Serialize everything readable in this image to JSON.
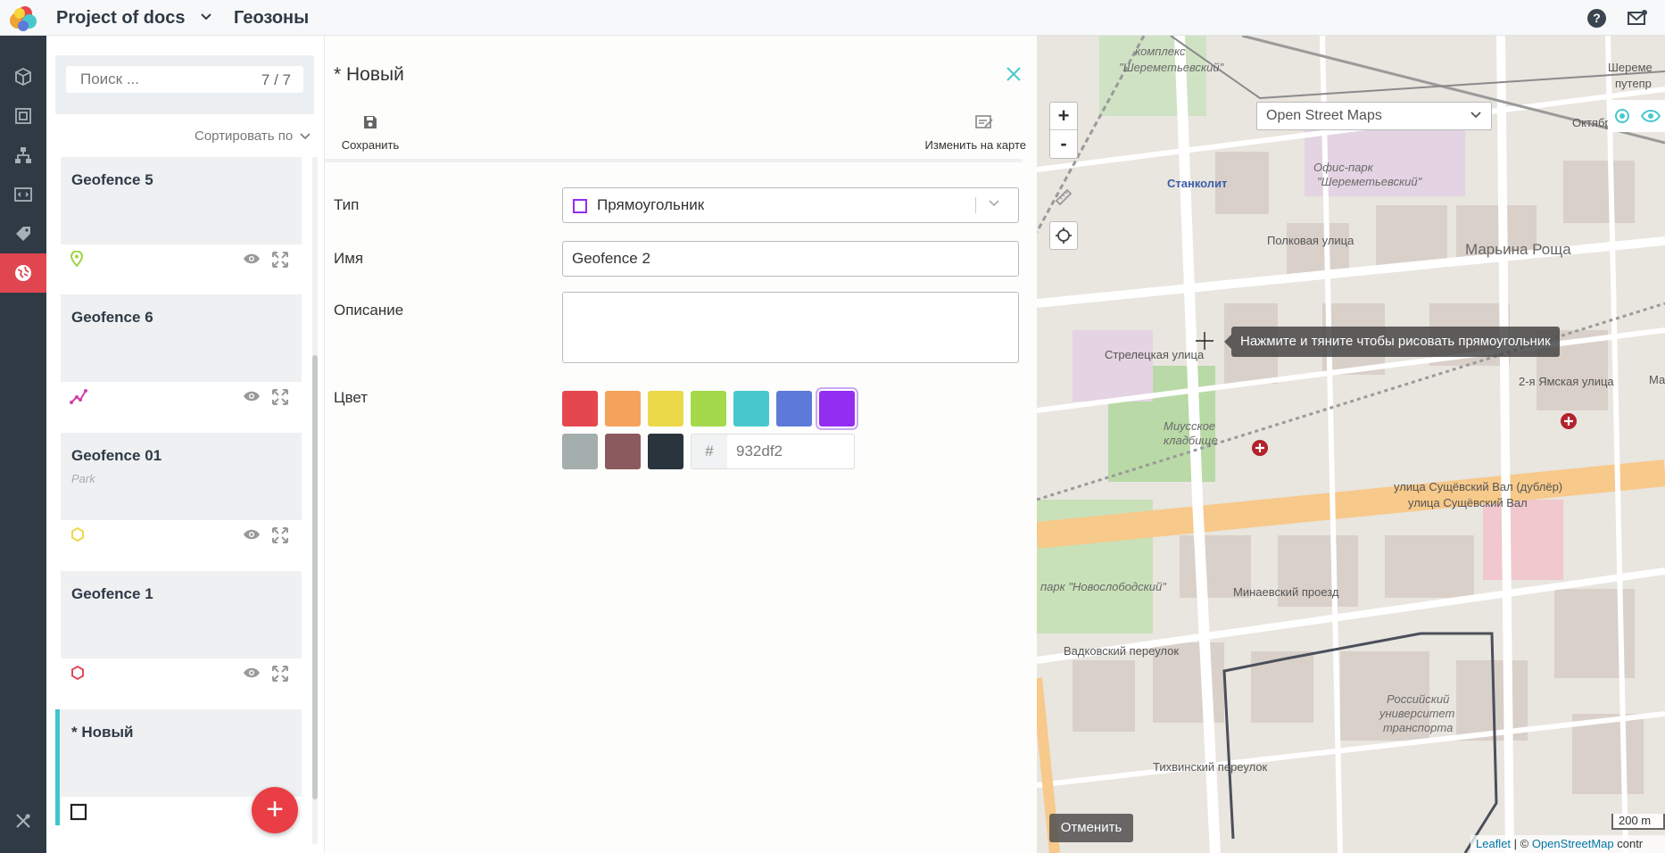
{
  "header": {
    "project_title": "Project of docs",
    "section_title": "Геозоны"
  },
  "rail": {
    "items": [
      {
        "icon": "cube-icon"
      },
      {
        "icon": "frame-icon"
      },
      {
        "icon": "hierarchy-icon"
      },
      {
        "icon": "code-icon"
      },
      {
        "icon": "tag-icon"
      },
      {
        "icon": "geofence-globe-icon",
        "active": true
      },
      {
        "icon": "tools-icon"
      }
    ]
  },
  "list": {
    "search_placeholder": "Поиск ...",
    "count": "7 / 7",
    "sort_label": "Сортировать по",
    "items": [
      {
        "name": "Geofence 5",
        "desc": "",
        "shape": "marker",
        "color": "#a0d346"
      },
      {
        "name": "Geofence 6",
        "desc": "",
        "shape": "polyline",
        "color": "#d63ea8"
      },
      {
        "name": "Geofence 01",
        "desc": "Park",
        "shape": "hexagon",
        "color": "#ecd94a"
      },
      {
        "name": "Geofence 1",
        "desc": "",
        "shape": "hexagon",
        "color": "#e24a5a"
      },
      {
        "name": "* Новый",
        "desc": "",
        "shape": "rectangle",
        "color": "#222222"
      }
    ],
    "fab_label": "+"
  },
  "editor": {
    "title": "* Новый",
    "save_label": "Сохранить",
    "edit_on_map_label": "Изменить на карте",
    "type_label": "Тип",
    "type_value": "Прямоугольник",
    "name_label": "Имя",
    "name_value": "Geofence 2",
    "description_label": "Описание",
    "description_value": "",
    "color_label": "Цвет",
    "colors": [
      "#e5474f",
      "#f5a35a",
      "#ecd94a",
      "#a3d94a",
      "#48c8cd",
      "#5d7ad9",
      "#932df2",
      "#a4aeac",
      "#8b5a5e",
      "#2a343d"
    ],
    "selected_color": "#932df2",
    "hex_prefix": "#",
    "hex_value": "932df2"
  },
  "map": {
    "layer": "Open Street Maps",
    "zoom_in": "+",
    "zoom_out": "-",
    "tooltip": "Нажмите и тяните чтобы рисовать прямоугольник",
    "cancel_label": "Отменить",
    "scale": "200 m",
    "attribution_leaflet": "Leaflet",
    "attribution_sep": " | © ",
    "attribution_osm": "OpenStreetMap",
    "attribution_tail": " contr",
    "labels": {
      "l1": "комплекс",
      "l2": "\"Шереметьевский\"",
      "l3": "Шереме",
      "l4": "путепр",
      "l5": "Офис-парк",
      "l6": "\"Шереметьевский\"",
      "l7": "Станколит",
      "l8": "Полковая улица",
      "l9": "Марьина Роща",
      "l10": "Стрелецкая улица",
      "l11": "Миусское",
      "l12": "кладбище",
      "l13": "улица Сущёвский Вал (дублёр)",
      "l14": "улица Сущёвский Вал",
      "l15": "Минаевский проезд",
      "l16": "Вадковский переулок",
      "l17": "Тихвинский переулок",
      "l18": "Российский",
      "l19": "университет",
      "l20": "транспорта",
      "l21": "парк \"Новослободский\"",
      "l22": "2-я Ямская улица",
      "l23": "Октябрьская улица",
      "l24": "Ма"
    }
  }
}
